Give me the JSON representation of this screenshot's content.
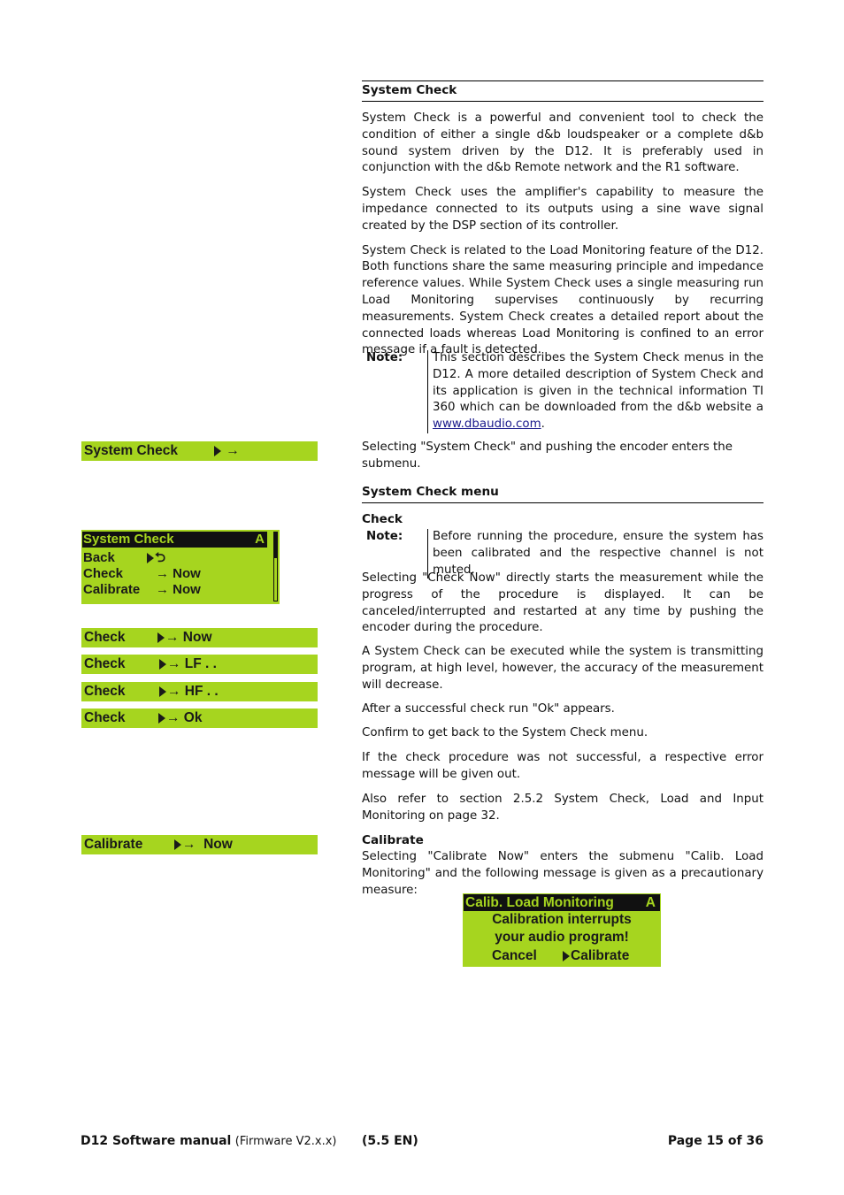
{
  "section": {
    "title": "System Check",
    "paragraphs": [
      "System Check is a powerful and convenient tool to check the condition of either a single d&b loudspeaker or a complete d&b sound system driven by the D12. It is preferably used in conjunction with the d&b Remote network and the R1 software.",
      "System Check uses the amplifier's capability to measure the impedance connected to its outputs using a sine wave signal created by the DSP section of its controller.",
      "System Check is related to the Load Monitoring feature of the D12. Both functions share the same measuring principle and impedance reference values. While System Check uses a single measuring run Load Monitoring supervises continuously by recurring measurements. System Check creates a detailed report about the connected loads whereas Load Monitoring is confined to an error message if a fault is detected."
    ],
    "note": {
      "label": "Note:",
      "text": "This section describes the System Check menus in the D12. A more detailed description of System Check and its application is given in the technical information TI 360 which can be downloaded from the d&b website a ",
      "link": "www.dbaudio.com",
      "after": "."
    },
    "select_text": "Selecting \"System Check\" and pushing the encoder enters the submenu."
  },
  "menu_section": {
    "title": "System Check menu",
    "check": {
      "heading": "Check",
      "note_label": "Note:",
      "note_text": "Before running the procedure, ensure the system has been calibrated and the respective channel is not muted.",
      "paragraphs": [
        "Selecting \"Check Now\" directly starts the measurement while the progress of the procedure is displayed. It can be canceled/interrupted and restarted at any time by pushing the encoder during the procedure.",
        "A System Check can be executed while the system is transmitting program, at high level, however, the accuracy of the measurement will decrease.",
        "After a successful check run \"Ok\" appears.",
        "Confirm to get back to the System Check menu.",
        "If the check procedure was not successful, a respective error message will be given out.",
        "Also refer to section 2.5.2 System Check, Load and Input Monitoring on page 32."
      ]
    },
    "calibrate": {
      "heading": "Calibrate",
      "text": "Selecting \"Calibrate Now\" enters the submenu \"Calib. Load Monitoring\" and the following message is given as a precautionary measure:"
    }
  },
  "lcd": {
    "color": "#a6d51f",
    "system_check_bar": {
      "label": "System Check",
      "arrow": "→"
    },
    "menu": {
      "title": "System Check",
      "channel": "A",
      "rows": [
        {
          "label": "Back",
          "value": "⮌"
        },
        {
          "label": "Check",
          "value": "→ Now"
        },
        {
          "label": "Calibrate",
          "value": "→ Now"
        }
      ]
    },
    "check_states": [
      {
        "label": "Check",
        "value": "→ Now"
      },
      {
        "label": "Check",
        "value": "→ LF . ."
      },
      {
        "label": "Check",
        "value": "→ HF . ."
      },
      {
        "label": "Check",
        "value": "→ Ok"
      }
    ],
    "calibrate_bar": {
      "label": "Calibrate",
      "value": "→  Now"
    },
    "dialog": {
      "title": "Calib. Load Monitoring",
      "channel": "A",
      "line1": "Calibration interrupts",
      "line2": "your audio program!",
      "cancel": "Cancel",
      "confirm": "Calibrate"
    }
  },
  "footer": {
    "manual": "D12 Software manual",
    "firmware": "(Firmware V2.x.x)",
    "version": "(5.5 EN)",
    "page": "Page 15 of 36"
  }
}
